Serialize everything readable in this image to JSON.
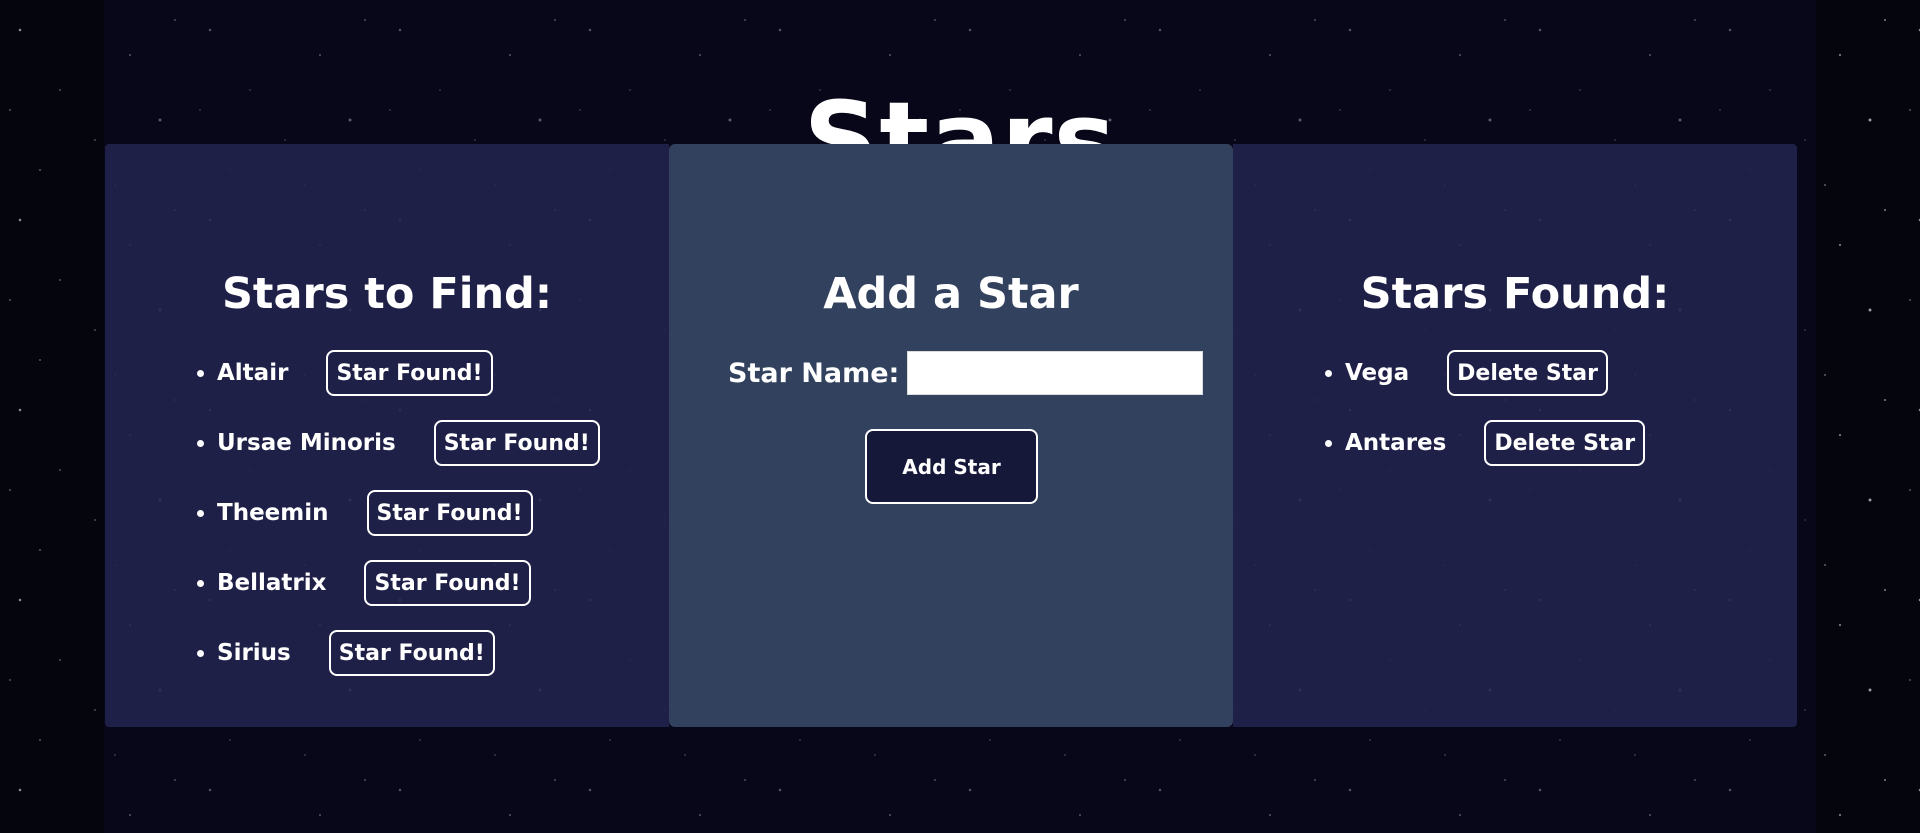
{
  "page": {
    "title": "Stars"
  },
  "to_find": {
    "heading": "Stars to Find:",
    "items": [
      {
        "name": "Altair",
        "button": "Star Found!"
      },
      {
        "name": "Ursae Minoris",
        "button": "Star Found!"
      },
      {
        "name": "Theemin",
        "button": "Star Found!"
      },
      {
        "name": "Bellatrix",
        "button": "Star Found!"
      },
      {
        "name": "Sirius",
        "button": "Star Found!"
      }
    ]
  },
  "add_star": {
    "heading": "Add a Star",
    "label": "Star Name:",
    "input_value": "",
    "button_label": "Add Star"
  },
  "found": {
    "heading": "Stars Found:",
    "items": [
      {
        "name": "Vega",
        "button": "Delete Star"
      },
      {
        "name": "Antares",
        "button": "Delete Star"
      }
    ]
  },
  "colors": {
    "background": "#05050d",
    "panel_side": "#242652",
    "panel_middle": "#32415e",
    "add_button": "#151838",
    "text": "#ffffff"
  }
}
